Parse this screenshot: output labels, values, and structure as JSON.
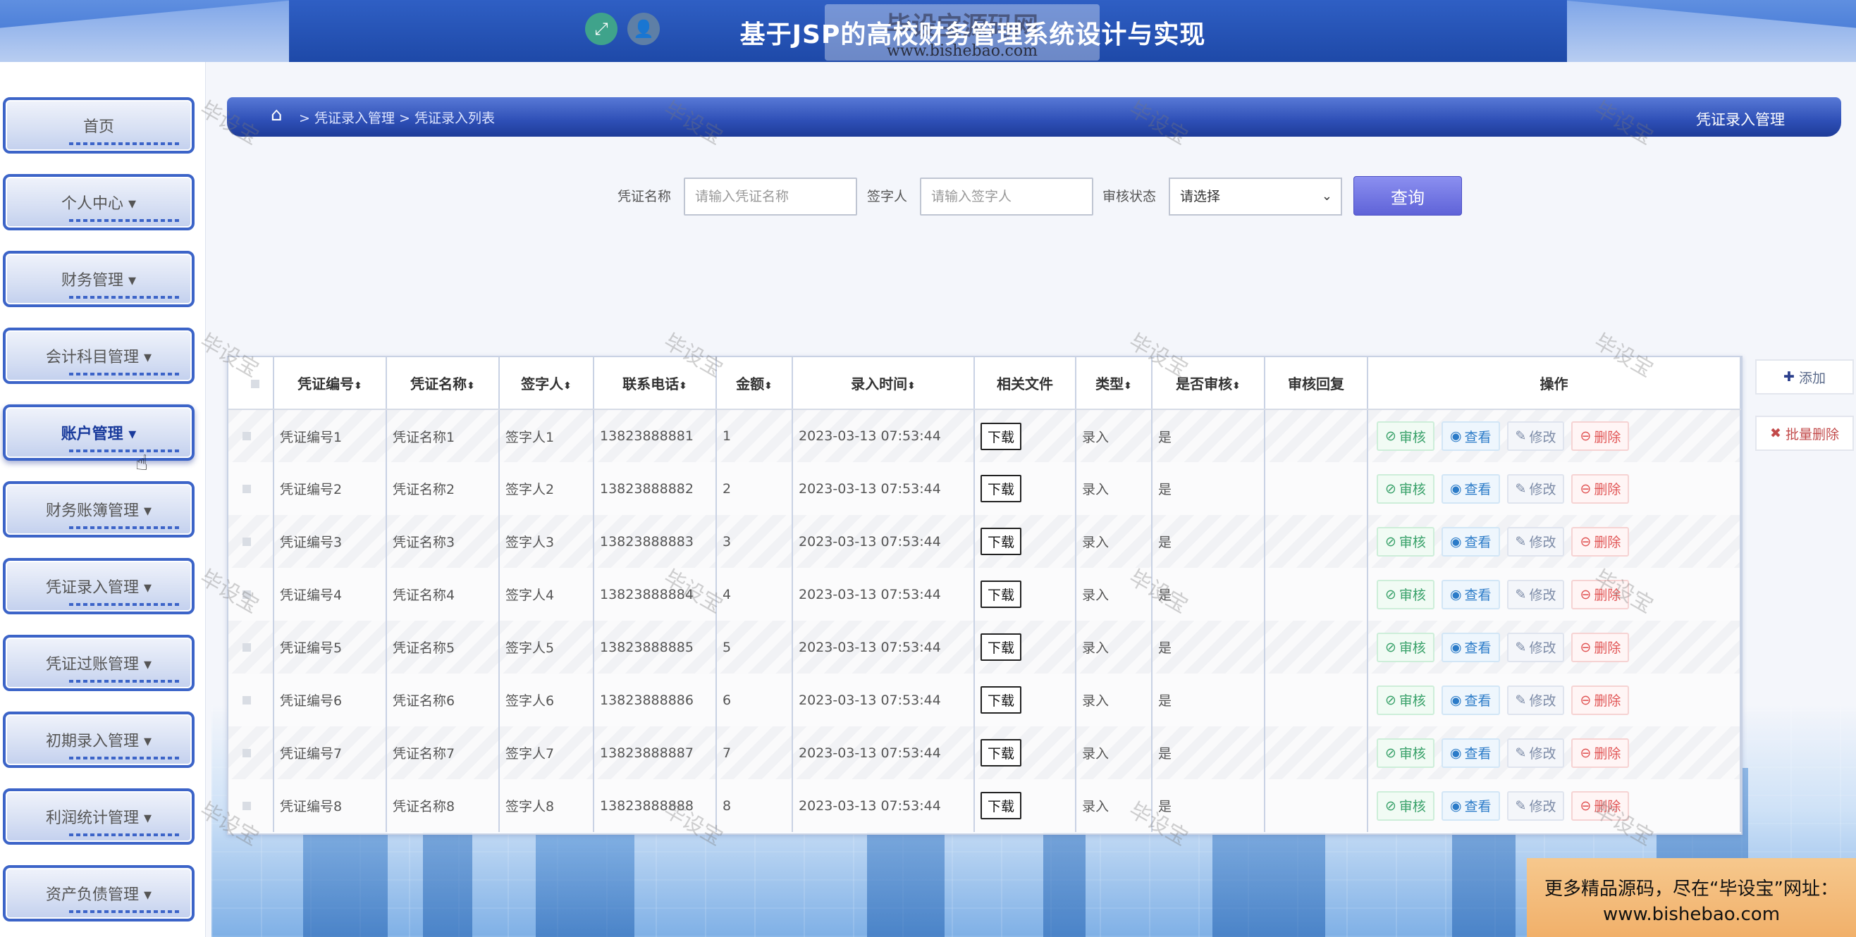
{
  "header": {
    "title": "基于JSP的高校财务管理系统设计与实现",
    "watermark_main": "毕设宝源码网",
    "watermark_url": "www.bishebao.com",
    "fullscreen_icon": "expand-icon",
    "user_icon": "user-icon"
  },
  "sidebar": {
    "items": [
      {
        "label": "首页"
      },
      {
        "label": "个人中心 ▾"
      },
      {
        "label": "财务管理 ▾"
      },
      {
        "label": "会计科目管理 ▾"
      },
      {
        "label": "账户管理 ▾"
      },
      {
        "label": "财务账簿管理 ▾"
      },
      {
        "label": "凭证录入管理 ▾"
      },
      {
        "label": "凭证过账管理 ▾"
      },
      {
        "label": "初期录入管理 ▾"
      },
      {
        "label": "利润统计管理 ▾"
      },
      {
        "label": "资产负债管理 ▾"
      }
    ]
  },
  "breadcrumb": {
    "path": "> 凭证录入管理 > 凭证录入列表",
    "right": "凭证录入管理"
  },
  "search": {
    "name_label": "凭证名称",
    "name_placeholder": "请输入凭证名称",
    "signer_label": "签字人",
    "signer_placeholder": "请输入签字人",
    "status_label": "审核状态",
    "status_value": "请选择",
    "button": "查询"
  },
  "table": {
    "headers": [
      "凭证编号",
      "凭证名称",
      "签字人",
      "联系电话",
      "金额",
      "录入时间",
      "相关文件",
      "类型",
      "是否审核",
      "审核回复",
      "操作"
    ],
    "rows": [
      {
        "no": "凭证编号1",
        "name": "凭证名称1",
        "signer": "签字人1",
        "phone": "13823888881",
        "amount": "1",
        "time": "2023-03-13 07:53:44",
        "file": "下载",
        "type": "录入",
        "audited": "是",
        "reply": ""
      },
      {
        "no": "凭证编号2",
        "name": "凭证名称2",
        "signer": "签字人2",
        "phone": "13823888882",
        "amount": "2",
        "time": "2023-03-13 07:53:44",
        "file": "下载",
        "type": "录入",
        "audited": "是",
        "reply": ""
      },
      {
        "no": "凭证编号3",
        "name": "凭证名称3",
        "signer": "签字人3",
        "phone": "13823888883",
        "amount": "3",
        "time": "2023-03-13 07:53:44",
        "file": "下载",
        "type": "录入",
        "audited": "是",
        "reply": ""
      },
      {
        "no": "凭证编号4",
        "name": "凭证名称4",
        "signer": "签字人4",
        "phone": "13823888884",
        "amount": "4",
        "time": "2023-03-13 07:53:44",
        "file": "下载",
        "type": "录入",
        "audited": "是",
        "reply": ""
      },
      {
        "no": "凭证编号5",
        "name": "凭证名称5",
        "signer": "签字人5",
        "phone": "13823888885",
        "amount": "5",
        "time": "2023-03-13 07:53:44",
        "file": "下载",
        "type": "录入",
        "audited": "是",
        "reply": ""
      },
      {
        "no": "凭证编号6",
        "name": "凭证名称6",
        "signer": "签字人6",
        "phone": "13823888886",
        "amount": "6",
        "time": "2023-03-13 07:53:44",
        "file": "下载",
        "type": "录入",
        "audited": "是",
        "reply": ""
      },
      {
        "no": "凭证编号7",
        "name": "凭证名称7",
        "signer": "签字人7",
        "phone": "13823888887",
        "amount": "7",
        "time": "2023-03-13 07:53:44",
        "file": "下载",
        "type": "录入",
        "audited": "是",
        "reply": ""
      },
      {
        "no": "凭证编号8",
        "name": "凭证名称8",
        "signer": "签字人8",
        "phone": "13823888888",
        "amount": "8",
        "time": "2023-03-13 07:53:44",
        "file": "下载",
        "type": "录入",
        "audited": "是",
        "reply": ""
      }
    ],
    "actions": {
      "audit": "审核",
      "view": "查看",
      "edit": "修改",
      "delete": "删除"
    }
  },
  "side_buttons": {
    "add": "添加",
    "batch_delete": "批量删除"
  },
  "promo": {
    "line1": "更多精品源码，尽在“毕设宝”网址：",
    "line2": "www.bishebao.com"
  },
  "watermark_text": "毕设宝",
  "colors": {
    "primary": "#3c64c8",
    "header": "#1e49a8",
    "search_button": "#5f63d8",
    "audit": "#38a169",
    "view": "#2b7bc8",
    "delete": "#e15555"
  }
}
